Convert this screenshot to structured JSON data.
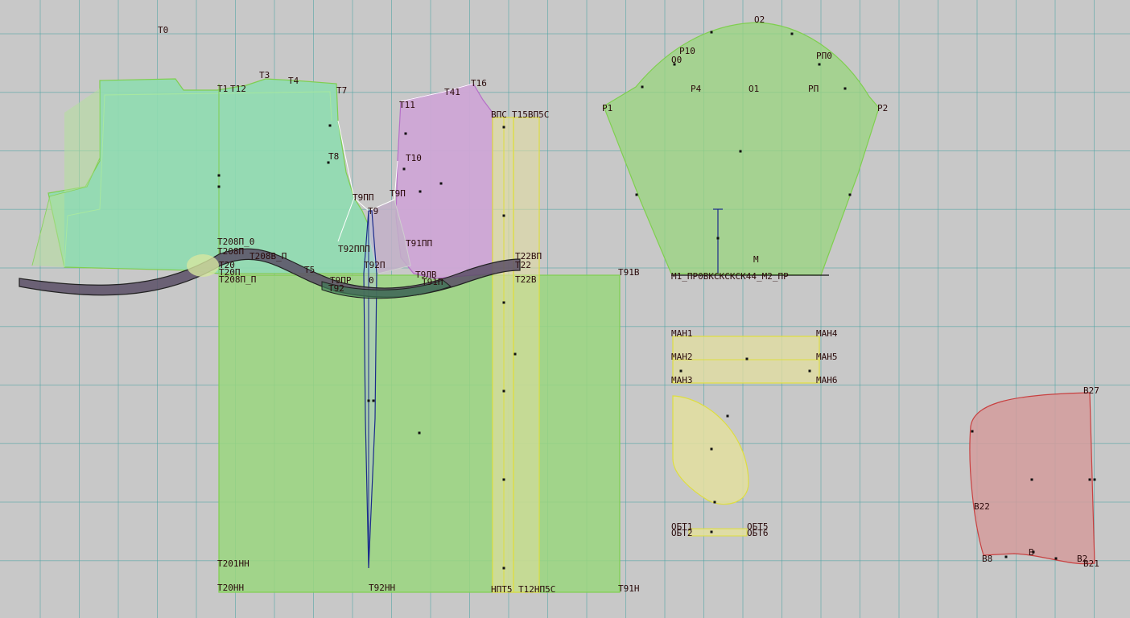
{
  "colors": {
    "background": "#c8c8c8",
    "grid": "#4aa3a3",
    "green_fill": "#9ad67f",
    "green_stroke": "#7fcf4f",
    "mint_fill": "#8fdcb0",
    "purple_fill": "#cfa7d6",
    "purple_stroke": "#b66fc8",
    "yellow_fill": "#e3df9f",
    "yellow_stroke": "#dede3f",
    "red_fill": "#d39c9c",
    "red_stroke": "#c84040",
    "band_fill": "#5b4f66",
    "dart_stroke": "#1a2a8a"
  },
  "labels": {
    "t0": "T0",
    "t12": "T12",
    "t1": "T1",
    "t3": "T3",
    "t4": "T4",
    "t7": "T7",
    "t8": "T8",
    "t11": "T11",
    "t41": "T41",
    "t16": "T16",
    "t10": "T10",
    "t9": "T9",
    "t9pp": "T9ПП",
    "t9p": "T9П",
    "t91pp": "T91ПП",
    "t208p_0": "T208П_0",
    "t208p": "T208П",
    "t208v_p": "T208В_П",
    "t20": "T20",
    "t20p": "T20П",
    "t208p_p": "T208П_П",
    "t5": "T5",
    "t92ppp": "T92ППП",
    "t92p": "T92П",
    "t9pr": "T9ПР",
    "t0b": "0",
    "t92": "T92",
    "t9lv": "T9ЛВ",
    "t91p": "T91П",
    "t22vp": "T22ВП",
    "t22": "T22",
    "t22v": "T22В",
    "t91v": "T91В",
    "vps": "ВПС",
    "t15vps": "T15ВП5С",
    "t201nn": "T201НН",
    "t20nn": "T20НН",
    "t92nn": "T92НН",
    "npts": "НПТ5",
    "t12nps": "T12НП5С",
    "t91n": "T91Н",
    "o2": "O2",
    "r10": "P10",
    "o0": "O0",
    "rp0": "PП0",
    "r4": "P4",
    "o1": "O1",
    "rp": "PП",
    "r1": "P1",
    "r2": "P2",
    "m": "M",
    "m1_row": "M1_ПР0ВКСКСКСК44_М2_ПР",
    "man1": "МАН1",
    "man4": "МАН4",
    "man2": "МАН2",
    "man5": "МАН5",
    "man3": "МАН3",
    "man6": "МАН6",
    "obt1": "ОБТ1",
    "obt5": "ОБТ5",
    "obt2": "ОБТ2",
    "obt6": "ОБТ6",
    "v27": "В27",
    "v22": "В22",
    "v8": "В8",
    "v9": "В",
    "v2": "В2",
    "v21": "В21"
  }
}
